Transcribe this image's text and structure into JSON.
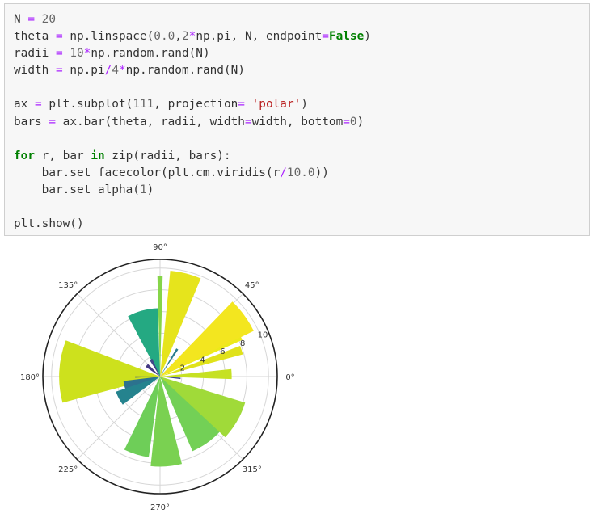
{
  "code_cell": {
    "lines": [
      [
        {
          "t": "N "
        },
        {
          "t": "=",
          "c": "op"
        },
        {
          "t": " "
        },
        {
          "t": "20",
          "c": "num"
        }
      ],
      [
        {
          "t": "theta "
        },
        {
          "t": "=",
          "c": "op"
        },
        {
          "t": " np.linspace("
        },
        {
          "t": "0.0",
          "c": "num"
        },
        {
          "t": ","
        },
        {
          "t": "2",
          "c": "num"
        },
        {
          "t": "*",
          "c": "op"
        },
        {
          "t": "np.pi, N, endpoint"
        },
        {
          "t": "=",
          "c": "op"
        },
        {
          "t": "False",
          "c": "kw"
        },
        {
          "t": ")"
        }
      ],
      [
        {
          "t": "radii "
        },
        {
          "t": "=",
          "c": "op"
        },
        {
          "t": " "
        },
        {
          "t": "10",
          "c": "num"
        },
        {
          "t": "*",
          "c": "op"
        },
        {
          "t": "np.random.rand(N)"
        }
      ],
      [
        {
          "t": "width "
        },
        {
          "t": "=",
          "c": "op"
        },
        {
          "t": " np.pi"
        },
        {
          "t": "/",
          "c": "op"
        },
        {
          "t": "4",
          "c": "num"
        },
        {
          "t": "*",
          "c": "op"
        },
        {
          "t": "np.random.rand(N)"
        }
      ],
      [],
      [
        {
          "t": "ax "
        },
        {
          "t": "=",
          "c": "op"
        },
        {
          "t": " plt.subplot("
        },
        {
          "t": "111",
          "c": "num"
        },
        {
          "t": ", projection"
        },
        {
          "t": "=",
          "c": "op"
        },
        {
          "t": " "
        },
        {
          "t": "'polar'",
          "c": "str"
        },
        {
          "t": ")"
        }
      ],
      [
        {
          "t": "bars "
        },
        {
          "t": "=",
          "c": "op"
        },
        {
          "t": " ax.bar(theta, radii, width"
        },
        {
          "t": "=",
          "c": "op"
        },
        {
          "t": "width, bottom"
        },
        {
          "t": "=",
          "c": "op"
        },
        {
          "t": "0",
          "c": "num"
        },
        {
          "t": ")"
        }
      ],
      [],
      [
        {
          "t": "for",
          "c": "kw"
        },
        {
          "t": " r, bar "
        },
        {
          "t": "in",
          "c": "kw"
        },
        {
          "t": " zip(radii, bars):"
        }
      ],
      [
        {
          "t": "    bar.set_facecolor(plt.cm.viridis(r"
        },
        {
          "t": "/",
          "c": "op"
        },
        {
          "t": "10.0",
          "c": "num"
        },
        {
          "t": "))"
        }
      ],
      [
        {
          "t": "    bar.set_alpha("
        },
        {
          "t": "1",
          "c": "num"
        },
        {
          "t": ")"
        }
      ],
      [],
      [
        {
          "t": "plt.show()"
        }
      ]
    ]
  },
  "chart_data": {
    "type": "polar-bar",
    "title": "",
    "angle_tick_labels": [
      "0°",
      "45°",
      "90°",
      "135°",
      "180°",
      "225°",
      "270°",
      "315°"
    ],
    "radial_tick_labels": [
      "2",
      "4",
      "6",
      "8",
      "10"
    ],
    "radial_ticks": [
      2,
      4,
      6,
      8,
      10
    ],
    "rlim": [
      0,
      10.8
    ],
    "grid": true,
    "colormap": "viridis",
    "bars": [
      {
        "theta_deg": 2,
        "width_deg": 8,
        "r": 6.6,
        "color": "#c6e123"
      },
      {
        "theta_deg": 18,
        "width_deg": 6,
        "r": 7.9,
        "color": "#e0e21a"
      },
      {
        "theta_deg": 30,
        "width_deg": 12,
        "r": 8.3,
        "color": "#ecea19"
      },
      {
        "theta_deg": 36,
        "width_deg": 20,
        "r": 9.6,
        "color": "#f3e61f"
      },
      {
        "theta_deg": 58,
        "width_deg": 4,
        "r": 3.0,
        "color": "#2b7d8e"
      },
      {
        "theta_deg": 76,
        "width_deg": 17,
        "r": 9.8,
        "color": "#e6e41c"
      },
      {
        "theta_deg": 90,
        "width_deg": 3,
        "r": 9.3,
        "color": "#86d549"
      },
      {
        "theta_deg": 105,
        "width_deg": 26,
        "r": 6.3,
        "color": "#24a982"
      },
      {
        "theta_deg": 118,
        "width_deg": 9,
        "r": 1.8,
        "color": "#3f4788"
      },
      {
        "theta_deg": 140,
        "width_deg": 12,
        "r": 1.6,
        "color": "#443983"
      },
      {
        "theta_deg": 177,
        "width_deg": 36,
        "r": 9.3,
        "color": "#cde11d"
      },
      {
        "theta_deg": 181,
        "width_deg": 3,
        "r": 2.3,
        "color": "#3b528b"
      },
      {
        "theta_deg": 195,
        "width_deg": 16,
        "r": 3.4,
        "color": "#2c728e"
      },
      {
        "theta_deg": 208,
        "width_deg": 18,
        "r": 4.3,
        "color": "#25838e"
      },
      {
        "theta_deg": 253,
        "width_deg": 18,
        "r": 7.5,
        "color": "#6ece58"
      },
      {
        "theta_deg": 274,
        "width_deg": 20,
        "r": 8.3,
        "color": "#7ad151"
      },
      {
        "theta_deg": 300,
        "width_deg": 8,
        "r": 4.6,
        "color": "#2b758e"
      },
      {
        "theta_deg": 307,
        "width_deg": 27,
        "r": 7.5,
        "color": "#73d056"
      },
      {
        "theta_deg": 330,
        "width_deg": 26,
        "r": 8.2,
        "color": "#a0da39"
      },
      {
        "theta_deg": 355,
        "width_deg": 4,
        "r": 1.9,
        "color": "#3e4a89"
      }
    ]
  }
}
